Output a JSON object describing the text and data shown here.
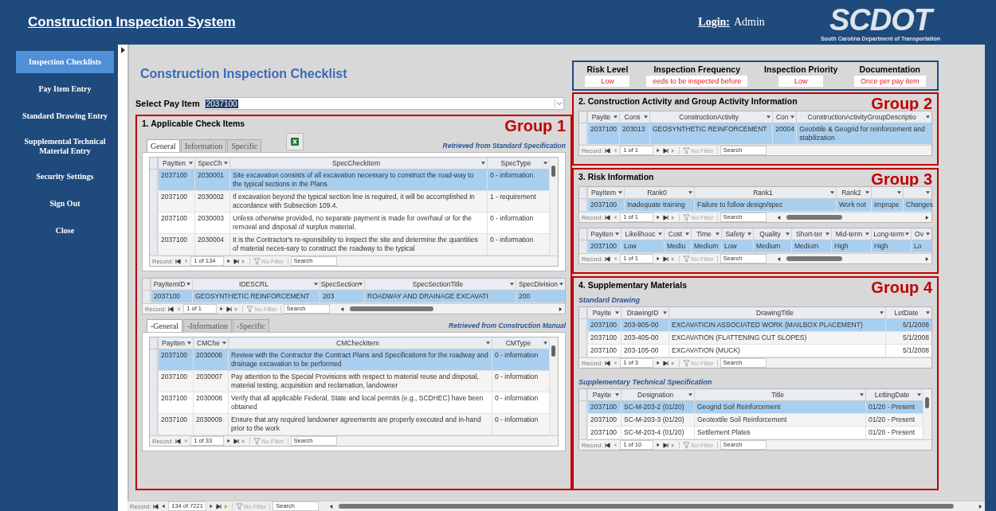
{
  "header": {
    "title": "Construction Inspection System",
    "login_label": "Login:",
    "login_user": "Admin",
    "logo": "SCDOT",
    "logo_caption": "South Carolina Department of Transportation"
  },
  "sidebar": {
    "items": [
      {
        "label": "Inspection Checklists",
        "selected": true
      },
      {
        "label": "Pay Item Entry",
        "selected": false
      },
      {
        "label": "Standard Drawing Entry",
        "selected": false
      },
      {
        "label": "Supplemental Technical Material Entry",
        "selected": false
      },
      {
        "label": "Security Settings",
        "selected": false
      },
      {
        "label": "Sign Out",
        "selected": false
      },
      {
        "label": "Close",
        "selected": false
      }
    ]
  },
  "page_title": "Construction Inspection Checklist",
  "pay_item": {
    "label": "Select Pay Item",
    "value": "2037100"
  },
  "status": [
    {
      "label": "Risk Level",
      "value": "Low"
    },
    {
      "label": "Inspection Frequency",
      "value": "eeds to be inspected before"
    },
    {
      "label": "Inspection Priority",
      "value": "Low"
    },
    {
      "label": "Documentation",
      "value": "Once per pay item"
    }
  ],
  "groups": [
    {
      "title": "1. Applicable Check Items",
      "tag": "Group 1",
      "blocks": [
        {
          "kind": "tabbed",
          "tabs": [
            {
              "label": "General",
              "selected": true
            },
            {
              "label": "Information",
              "selected": false
            },
            {
              "label": "Specific",
              "selected": false
            }
          ],
          "export_button": true,
          "note": "Retrieved from Standard Specification",
          "grid": {
            "columns": [
              {
                "label": "PayIten"
              },
              {
                "label": "SpecCh"
              },
              {
                "label": "SpecCheckItem"
              },
              {
                "label": "SpecType"
              }
            ],
            "rows": [
              {
                "cells": [
                  "2037100",
                  "2030001",
                  "Site excavation consists of all excavation necessary to construct the road-way to the typical sections in the Plans.",
                  "0 - information"
                ],
                "selected": true
              },
              {
                "cells": [
                  "2037100",
                  "2030002",
                  "If excavation beyond the typical section line is required, it will be accomplished in accordance with Subsection 109.4.",
                  "1 - requirement"
                ],
                "selected": false
              },
              {
                "cells": [
                  "2037100",
                  "2030003",
                  "Unless otherwise provided, no separate payment is made for overhaul or for the removal and disposal of surplus material.",
                  "0 - information"
                ],
                "selected": false
              },
              {
                "cells": [
                  "2037100",
                  "2030004",
                  "It is the Contractor's re-sponsibility to inspect the site and determine the quantities of material neces-sary to construct the roadway to the typical",
                  "0 - information"
                ],
                "selected": false
              }
            ],
            "nav": {
              "label": "Record:",
              "position": "1 of 134",
              "filter": "No Filter",
              "search": "Search"
            }
          }
        },
        {
          "kind": "grid",
          "grid": {
            "columns": [
              {
                "label": "PayItemID"
              },
              {
                "label": "IDESCRL"
              },
              {
                "label": "SpecSection"
              },
              {
                "label": "SpecSectionTitle"
              },
              {
                "label": "SpecDivision"
              }
            ],
            "rows": [
              {
                "cells": [
                  "2037100",
                  "GEOSYNTHETIC  REINFORCEMENT",
                  "203",
                  "ROADWAY AND DRAINAGE EXCAVATI",
                  "200"
                ],
                "selected": true
              }
            ],
            "nav": {
              "label": "Record:",
              "position": "1 of 1",
              "filter": "No Filter",
              "search": "Search"
            }
          }
        },
        {
          "kind": "tabbed",
          "tabs": [
            {
              "label": "-General",
              "selected": true
            },
            {
              "label": "-Information",
              "selected": false
            },
            {
              "label": "-Specific",
              "selected": false
            }
          ],
          "note": "Retrieved from Construction Manual",
          "grid": {
            "columns": [
              {
                "label": "PayIten"
              },
              {
                "label": "CMChe"
              },
              {
                "label": "CMCheckItem"
              },
              {
                "label": "CMType"
              }
            ],
            "rows": [
              {
                "cells": [
                  "2037100",
                  "2030006",
                  "Review with the Contractor the Contract Plans and Specifications for the roadway and drainage excavation to be performed",
                  "0 - information"
                ],
                "selected": true
              },
              {
                "cells": [
                  "2037100",
                  "2030007",
                  "Pay attention to the Special Provisions with respect to material reuse and disposal, material testing, acquisition and reclamation, landowner",
                  "0 - information"
                ],
                "selected": false
              },
              {
                "cells": [
                  "2037100",
                  "2030008",
                  "Verify that all applicable Federal, State and local permits (e.g., SCDHEC) have been obtained",
                  "0 - information"
                ],
                "selected": false
              },
              {
                "cells": [
                  "2037100",
                  "2030009",
                  "Ensure that any required landowner agreements are properly executed and in-hand prior to the work",
                  "0 - information"
                ],
                "selected": false
              }
            ],
            "nav": {
              "label": "Record:",
              "position": "1 of 33",
              "filter": "No Filter",
              "search": "Search"
            }
          }
        }
      ]
    },
    {
      "title": "2. Construction Activity and Group Activity Information",
      "tag": "Group 2",
      "blocks": [
        {
          "kind": "grid",
          "grid": {
            "columns": [
              {
                "label": "Payite"
              },
              {
                "label": "Cons"
              },
              {
                "label": "ConstructionActivity"
              },
              {
                "label": "Con"
              },
              {
                "label": "ConstructionActivityGroupDescriptio"
              }
            ],
            "rows": [
              {
                "cells": [
                  "2037100",
                  "203013",
                  "GEOSYNTHETIC  REINFORCEMENT",
                  "20004",
                  "Geotxtile & Geogrid for reinforcement and stabilization"
                ],
                "selected": true
              }
            ],
            "nav": {
              "label": "Record:",
              "position": "1 of 1",
              "filter": "No Filter",
              "search": "Search"
            }
          }
        }
      ]
    },
    {
      "title": "3. Risk Information",
      "tag": "Group 3",
      "blocks": [
        {
          "kind": "grid",
          "grid": {
            "columns": [
              {
                "label": "PayItem"
              },
              {
                "label": "Rank0"
              },
              {
                "label": "Rank1"
              },
              {
                "label": "Rank2"
              },
              {},
              {}
            ],
            "rows": [
              {
                "cells": [
                  "2037100",
                  "Inadequate training",
                  "Failure to follow design/spec",
                  "Work not",
                  "Imprope",
                  "Changes"
                ],
                "selected": true
              }
            ],
            "nav": {
              "label": "Record:",
              "position": "1 of 1",
              "filter": "No Filter",
              "search": "Search"
            }
          }
        },
        {
          "kind": "grid",
          "grid": {
            "columns": [
              {
                "label": "Payiten"
              },
              {
                "label": "Likelihooc"
              },
              {
                "label": "Cost"
              },
              {
                "label": "Time"
              },
              {
                "label": "Safety"
              },
              {
                "label": "Quality"
              },
              {
                "label": "Short-ter"
              },
              {
                "label": "Mid-term"
              },
              {
                "label": "Long-term"
              },
              {
                "label": "Ov"
              }
            ],
            "rows": [
              {
                "cells": [
                  "2037100",
                  "Low",
                  "Mediu",
                  "Medium",
                  "Low",
                  "Medium",
                  "Medium",
                  "High",
                  "High",
                  "Lo"
                ],
                "selected": true
              }
            ],
            "nav": {
              "label": "Record:",
              "position": "1 of 1",
              "filter": "No Filter",
              "search": "Search"
            }
          }
        }
      ]
    },
    {
      "title": "4. Supplementary Materials",
      "tag": "Group 4",
      "blocks": [
        {
          "kind": "subheading",
          "text": "Standard Drawing"
        },
        {
          "kind": "grid",
          "grid": {
            "columns": [
              {
                "label": "Payite"
              },
              {
                "label": "DrawingID"
              },
              {
                "label": "DrawingTitle"
              },
              {
                "label": "LetDate"
              }
            ],
            "rows": [
              {
                "cells": [
                  "2037100",
                  "203-905-00",
                  "EXCAVATICIN ASSOCIATED WORK (MAILBOX PLACEMENT)",
                  "5/1/2008"
                ],
                "selected": true
              },
              {
                "cells": [
                  "2037100",
                  "203-405-00",
                  "EXCAVATION (FLATTENING CUT SLOPES)",
                  "5/1/2008"
                ],
                "selected": false
              },
              {
                "cells": [
                  "2037100",
                  "203-105-00",
                  "EXCAVATION (MUCK)",
                  "5/1/2008"
                ],
                "selected": false
              }
            ],
            "nav": {
              "label": "Record:",
              "position": "1 of 3",
              "filter": "No Filter",
              "search": "Search"
            }
          }
        },
        {
          "kind": "subheading",
          "text": "Supplementary Technical Specification"
        },
        {
          "kind": "grid",
          "grid": {
            "columns": [
              {
                "label": "Payite"
              },
              {
                "label": "Designation"
              },
              {
                "label": "Title"
              },
              {
                "label": "LettingDate"
              }
            ],
            "rows": [
              {
                "cells": [
                  "2037100",
                  "SC-M-203-2 (01/20)",
                  "Geogrid Soil Reinforcement",
                  "01/20 - Present"
                ],
                "selected": true
              },
              {
                "cells": [
                  "2037100",
                  "SC-M-203-3 (01/20)",
                  "Geotextile Soil Reinforcement",
                  "01/20 - Present"
                ],
                "selected": false
              },
              {
                "cells": [
                  "2037100",
                  "SC-M-203-4 (01/20)",
                  "Settlement Plates",
                  "01/20 - Present"
                ],
                "selected": false
              }
            ],
            "nav": {
              "label": "Record:",
              "position": "1 of 10",
              "filter": "No Filter",
              "search": "Search"
            }
          }
        }
      ]
    }
  ],
  "bottom_nav": {
    "label": "Record:",
    "position": "134 of 7221",
    "filter": "No Filter",
    "search": "Search"
  }
}
